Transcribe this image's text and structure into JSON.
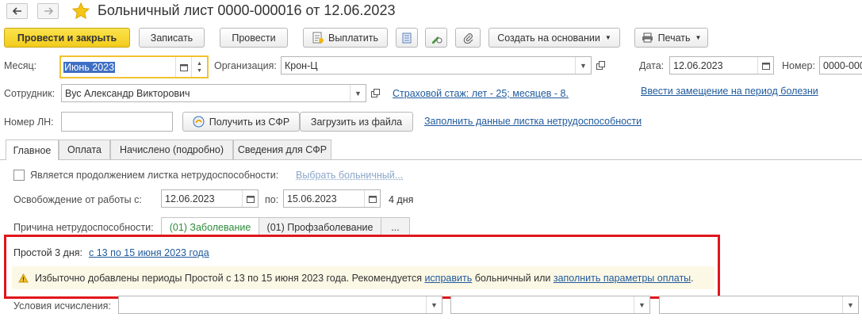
{
  "window": {
    "title": "Больничный лист 0000-000016 от 12.06.2023"
  },
  "toolbar": {
    "post_close": "Провести и закрыть",
    "save": "Записать",
    "post": "Провести",
    "pay": "Выплатить",
    "create_based": "Создать на основании",
    "print": "Печать"
  },
  "form": {
    "month_label": "Месяц:",
    "month_value": "Июнь 2023",
    "org_label": "Организация:",
    "org_value": "Крон-Ц",
    "date_label": "Дата:",
    "date_value": "12.06.2023",
    "number_label": "Номер:",
    "number_value": "0000-000",
    "employee_label": "Сотрудник:",
    "employee_value": "Вус Александр Викторович",
    "insurance_link": "Страховой стаж: лет - 25; месяцев - 8.",
    "replacement_link": "Ввести замещение на период болезни",
    "ln_label": "Номер ЛН:",
    "ln_value": "",
    "get_sfr": "Получить из СФР",
    "load_file": "Загрузить из файла",
    "fill_link": "Заполнить данные листка нетрудоспособности"
  },
  "tabs": [
    {
      "label": "Главное"
    },
    {
      "label": "Оплата"
    },
    {
      "label": "Начислено (подробно)"
    },
    {
      "label": "Сведения для СФР"
    }
  ],
  "main": {
    "continuation_label": "Является продолжением листка нетрудоспособности:",
    "continuation_checked": false,
    "select_link": "Выбрать больничный...",
    "release_label": "Освобождение от работы с:",
    "release_from": "12.06.2023",
    "release_to_label": "по:",
    "release_to": "15.06.2023",
    "days": "4 дня",
    "reason_label": "Причина нетрудоспособности:",
    "reason_opt1": "(01) Заболевание",
    "reason_opt2": "(01) Профзаболевание",
    "reason_more": "...",
    "downtime_label": "Простой 3 дня:",
    "downtime_link": "с 13 по 15 июня 2023 года",
    "warn_text1": "Избыточно добавлены периоды Простой с 13 по 15 июня 2023 года. Рекомендуется",
    "warn_link1": "исправить",
    "warn_text2": "больничный или",
    "warn_link2": "заполнить параметры оплаты",
    "warn_text3": ".",
    "calc_label": "Условия исчисления:",
    "calc_value1": "",
    "calc_value2": "",
    "calc_value3": ""
  },
  "colors": {
    "primary_button": "#f5d22b",
    "link": "#1f5a9d",
    "highlight_frame": "#e0161b",
    "warning_bg": "#fcf8e6",
    "reason_selected_text": "#2e8b3a"
  }
}
